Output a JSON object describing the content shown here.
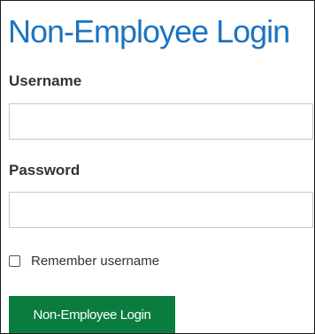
{
  "login": {
    "title": "Non-Employee Login",
    "username_label": "Username",
    "username_value": "",
    "password_label": "Password",
    "password_value": "",
    "remember_label": "Remember username",
    "remember_checked": false,
    "submit_label": "Non-Employee Login"
  },
  "colors": {
    "title": "#1e73be",
    "button": "#0a7d3e",
    "label": "#333333"
  }
}
